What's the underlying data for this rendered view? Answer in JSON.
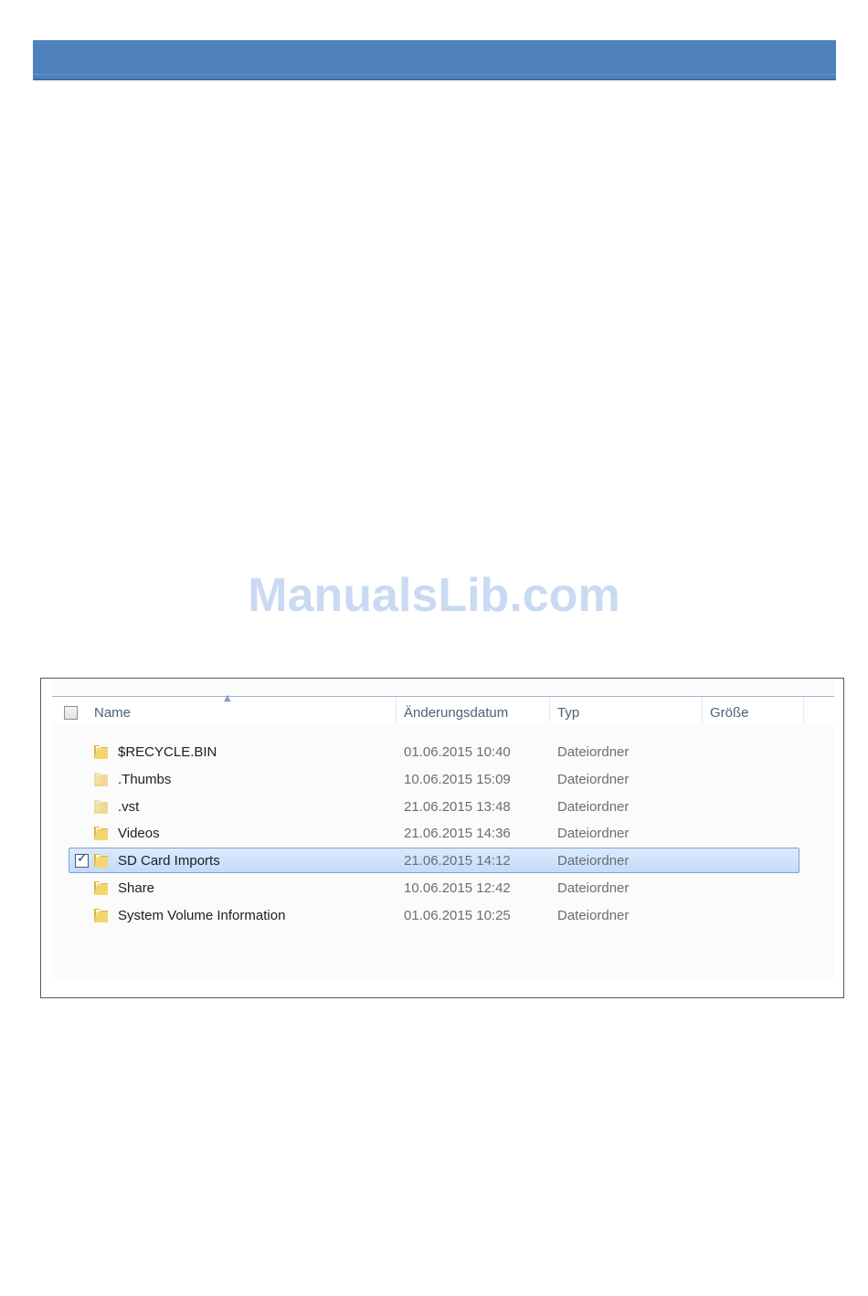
{
  "watermark": "ManualsLib.com",
  "explorer": {
    "columns": {
      "name": "Name",
      "date": "Änderungsdatum",
      "type": "Typ",
      "size": "Größe"
    },
    "rows": [
      {
        "name": "$RECYCLE.BIN",
        "date": "01.06.2015 10:40",
        "type": "Dateiordner",
        "icon": "folder-icon",
        "faded": false,
        "selected": false
      },
      {
        "name": ".Thumbs",
        "date": "10.06.2015 15:09",
        "type": "Dateiordner",
        "icon": "folder-icon",
        "faded": true,
        "selected": false
      },
      {
        "name": ".vst",
        "date": "21.06.2015 13:48",
        "type": "Dateiordner",
        "icon": "folder-icon",
        "faded": true,
        "selected": false
      },
      {
        "name": "Videos",
        "date": "21.06.2015 14:36",
        "type": "Dateiordner",
        "icon": "folder-icon",
        "faded": false,
        "selected": false
      },
      {
        "name": "SD Card Imports",
        "date": "21.06.2015 14:12",
        "type": "Dateiordner",
        "icon": "folder-icon",
        "faded": false,
        "selected": true
      },
      {
        "name": "Share",
        "date": "10.06.2015 12:42",
        "type": "Dateiordner",
        "icon": "folder-icon",
        "faded": false,
        "selected": false
      },
      {
        "name": "System Volume Information",
        "date": "01.06.2015 10:25",
        "type": "Dateiordner",
        "icon": "folder-icon",
        "faded": false,
        "selected": false
      }
    ]
  }
}
